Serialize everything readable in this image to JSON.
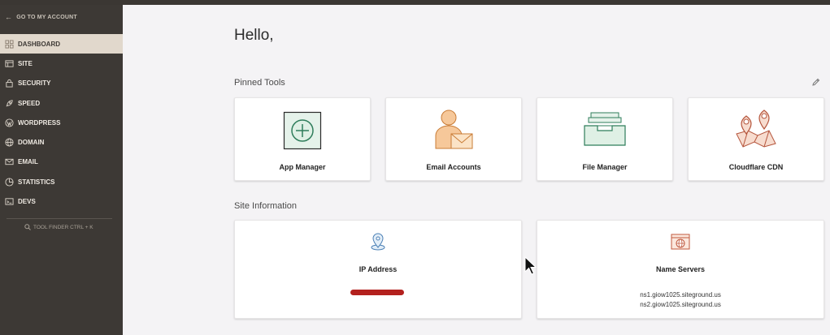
{
  "sidebar": {
    "back_label": "GO TO MY ACCOUNT",
    "items": [
      {
        "label": "DASHBOARD",
        "icon": "dashboard-grid-icon",
        "active": true
      },
      {
        "label": "SITE",
        "icon": "site-icon"
      },
      {
        "label": "SECURITY",
        "icon": "lock-icon"
      },
      {
        "label": "SPEED",
        "icon": "rocket-icon"
      },
      {
        "label": "WORDPRESS",
        "icon": "wordpress-icon"
      },
      {
        "label": "DOMAIN",
        "icon": "globe-icon"
      },
      {
        "label": "EMAIL",
        "icon": "envelope-icon"
      },
      {
        "label": "STATISTICS",
        "icon": "pie-chart-icon"
      },
      {
        "label": "DEVS",
        "icon": "terminal-icon"
      }
    ],
    "tool_finder": "TOOL FINDER CTRL + K"
  },
  "main": {
    "greeting": "Hello,",
    "pinned_title": "Pinned Tools",
    "pinned": [
      {
        "label": "App Manager",
        "icon": "app-manager-icon"
      },
      {
        "label": "Email Accounts",
        "icon": "email-accounts-icon"
      },
      {
        "label": "File Manager",
        "icon": "file-manager-icon"
      },
      {
        "label": "Cloudflare CDN",
        "icon": "cloudflare-map-icon"
      }
    ],
    "site_info_title": "Site Information",
    "ip_label": "IP Address",
    "ns_label": "Name Servers",
    "nameservers": [
      "ns1.giow1025.siteground.us",
      "ns2.giow1025.siteground.us"
    ]
  },
  "colors": {
    "sidebar_bg": "#3d3935",
    "active_bg": "#e1d8cc",
    "green_icon": "#2f7d5b",
    "orange_icon": "#e8a35a",
    "red_icon": "#b5553c",
    "redaction": "#b3211e"
  }
}
